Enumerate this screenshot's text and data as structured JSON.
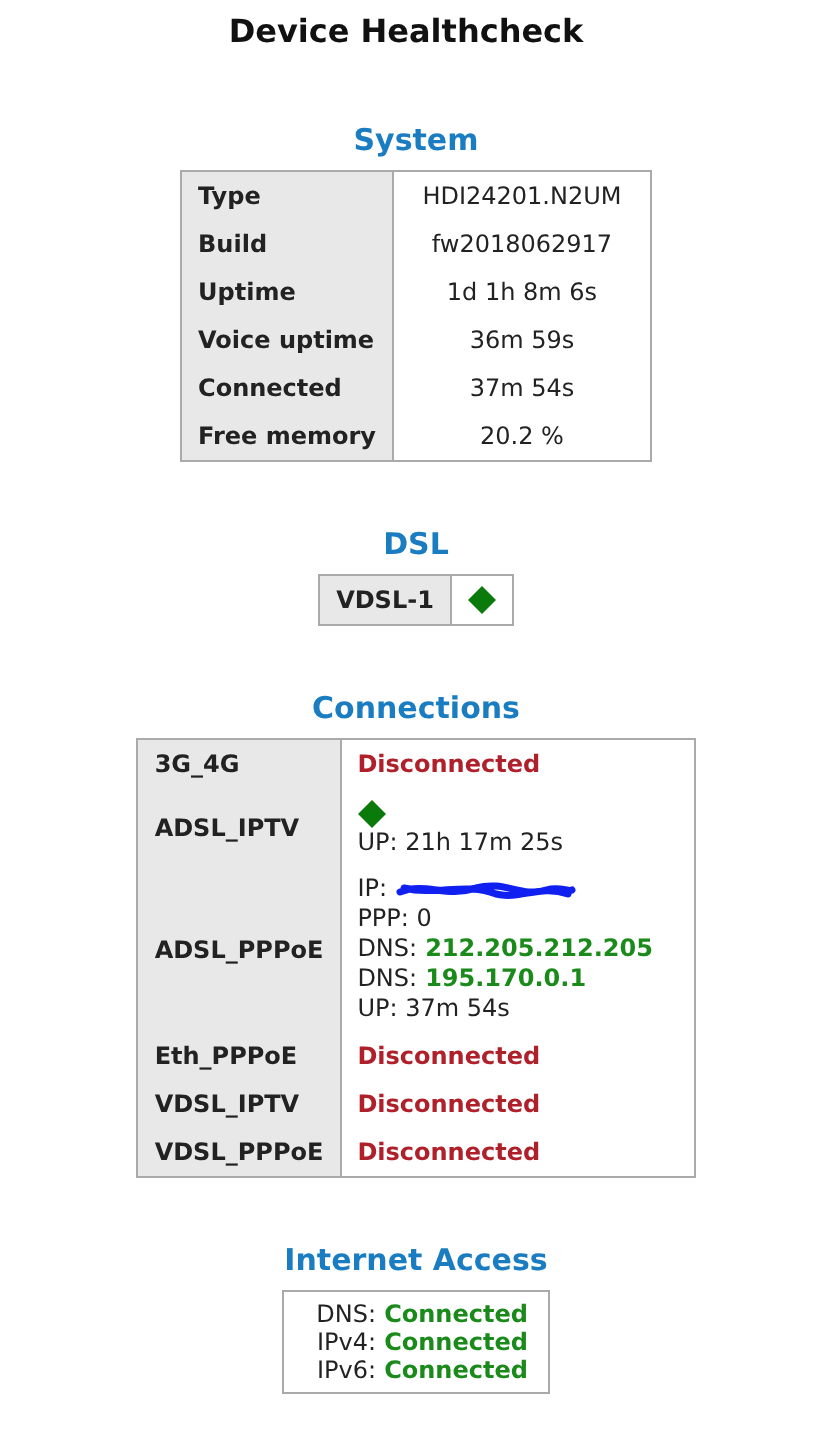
{
  "title": "Device Healthcheck",
  "system": {
    "heading": "System",
    "rows": [
      {
        "label": "Type",
        "value": "HDI24201.N2UM"
      },
      {
        "label": "Build",
        "value": "fw2018062917"
      },
      {
        "label": "Uptime",
        "value": "1d 1h 8m 6s"
      },
      {
        "label": "Voice uptime",
        "value": "36m 59s"
      },
      {
        "label": "Connected",
        "value": "37m 54s"
      },
      {
        "label": "Free memory",
        "value": "20.2 %"
      }
    ]
  },
  "dsl": {
    "heading": "DSL",
    "lines": [
      {
        "name": "VDSL-1",
        "up": true
      }
    ]
  },
  "connections": {
    "heading": "Connections",
    "rows": [
      {
        "name": "3G_4G",
        "kind": "status",
        "status": "Disconnected"
      },
      {
        "name": "ADSL_IPTV",
        "kind": "details",
        "up": true,
        "lines": [
          {
            "label": "UP: 21h 17m 25s"
          }
        ]
      },
      {
        "name": "ADSL_PPPoE",
        "kind": "details",
        "lines": [
          {
            "label": "IP:",
            "redacted": true
          },
          {
            "label": "PPP: 0"
          },
          {
            "label": "DNS:",
            "value": "212.205.212.205"
          },
          {
            "label": "DNS:",
            "value": "195.170.0.1"
          },
          {
            "label": "UP: 37m 54s"
          }
        ]
      },
      {
        "name": "Eth_PPPoE",
        "kind": "status",
        "status": "Disconnected"
      },
      {
        "name": "VDSL_IPTV",
        "kind": "status",
        "status": "Disconnected"
      },
      {
        "name": "VDSL_PPPoE",
        "kind": "status",
        "status": "Disconnected"
      }
    ]
  },
  "internet_access": {
    "heading": "Internet Access",
    "rows": [
      {
        "label": "DNS:",
        "value": "Connected"
      },
      {
        "label": "IPv4:",
        "value": "Connected"
      },
      {
        "label": "IPv6:",
        "value": "Connected"
      }
    ]
  }
}
